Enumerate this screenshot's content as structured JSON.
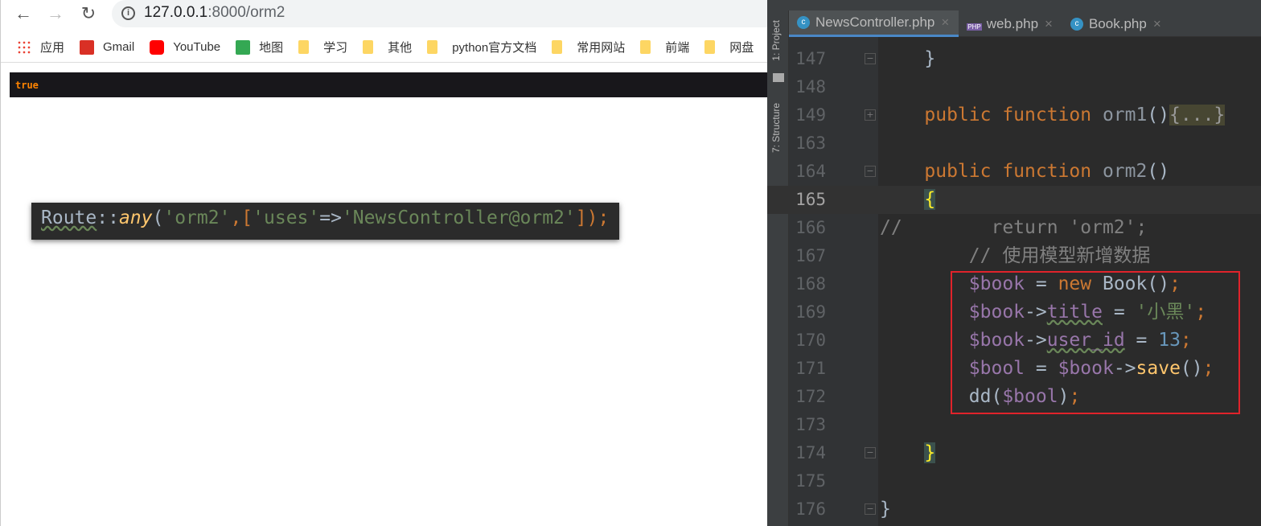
{
  "browser": {
    "url_host": "127.0.0.1",
    "url_path": ":8000/orm2",
    "bookmarks": [
      {
        "label": "应用",
        "icon": "apps-grid-icon"
      },
      {
        "label": "Gmail",
        "icon": "gmail-icon"
      },
      {
        "label": "YouTube",
        "icon": "youtube-icon"
      },
      {
        "label": "地图",
        "icon": "maps-icon"
      },
      {
        "label": "学习",
        "icon": "folder-icon"
      },
      {
        "label": "其他",
        "icon": "folder-icon"
      },
      {
        "label": "python官方文档",
        "icon": "folder-icon"
      },
      {
        "label": "常用网站",
        "icon": "folder-icon"
      },
      {
        "label": "前端",
        "icon": "folder-icon"
      },
      {
        "label": "网盘",
        "icon": "folder-icon"
      }
    ],
    "dump_output": "true"
  },
  "tooltip": {
    "tokens": [
      {
        "t": "Route",
        "k": "wavy"
      },
      {
        "t": "::",
        "k": ""
      },
      {
        "t": "any",
        "k": "ital"
      },
      {
        "t": "(",
        "k": ""
      },
      {
        "t": "'orm2'",
        "k": "str"
      },
      {
        "t": ",[",
        "k": "kw"
      },
      {
        "t": "'uses'",
        "k": "str"
      },
      {
        "t": "=>",
        "k": ""
      },
      {
        "t": "'NewsController@orm2'",
        "k": "str"
      },
      {
        "t": "]);",
        "k": "kw"
      }
    ]
  },
  "ide": {
    "side_tools": [
      "1: Project",
      "7: Structure"
    ],
    "tabs": [
      {
        "label": "NewsController.php",
        "icon": "class-icon",
        "active": true
      },
      {
        "label": "web.php",
        "icon": "php-file-icon"
      },
      {
        "label": "Book.php",
        "icon": "class-icon"
      }
    ],
    "current_line": "165",
    "lines": [
      {
        "n": "147",
        "fold": "-",
        "tokens": [
          {
            "t": "    }",
            "k": ""
          }
        ]
      },
      {
        "n": "148",
        "tokens": []
      },
      {
        "n": "149",
        "fold": "+",
        "tokens": [
          {
            "t": "    public function ",
            "k": "kw"
          },
          {
            "t": "orm1",
            "k": "dim"
          },
          {
            "t": "()",
            "k": ""
          },
          {
            "t": "{...}",
            "k": "folded"
          }
        ]
      },
      {
        "n": "163",
        "tokens": []
      },
      {
        "n": "164",
        "fold": "-",
        "tokens": [
          {
            "t": "    public function ",
            "k": "kw"
          },
          {
            "t": "orm2",
            "k": "dim"
          },
          {
            "t": "()",
            "k": ""
          }
        ]
      },
      {
        "n": "165",
        "tokens": [
          {
            "t": "    ",
            "k": ""
          },
          {
            "t": "{",
            "k": "br"
          }
        ]
      },
      {
        "n": "166",
        "tokens": [
          {
            "t": "//        return 'orm2';",
            "k": "cm"
          }
        ]
      },
      {
        "n": "167",
        "tokens": [
          {
            "t": "        // 使用模型新增数据",
            "k": "cm"
          }
        ]
      },
      {
        "n": "168",
        "tokens": [
          {
            "t": "        ",
            "k": ""
          },
          {
            "t": "$book",
            "k": "var"
          },
          {
            "t": " = ",
            "k": ""
          },
          {
            "t": "new ",
            "k": "kw"
          },
          {
            "t": "Book()",
            "k": ""
          },
          {
            "t": ";",
            "k": "kw"
          }
        ]
      },
      {
        "n": "169",
        "tokens": [
          {
            "t": "        ",
            "k": ""
          },
          {
            "t": "$book",
            "k": "var"
          },
          {
            "t": "->",
            "k": ""
          },
          {
            "t": "title",
            "k": "var wavy"
          },
          {
            "t": " = ",
            "k": ""
          },
          {
            "t": "'小黑'",
            "k": "str"
          },
          {
            "t": ";",
            "k": "kw"
          }
        ]
      },
      {
        "n": "170",
        "tokens": [
          {
            "t": "        ",
            "k": ""
          },
          {
            "t": "$book",
            "k": "var"
          },
          {
            "t": "->",
            "k": ""
          },
          {
            "t": "user_id",
            "k": "var wavy"
          },
          {
            "t": " = ",
            "k": ""
          },
          {
            "t": "13",
            "k": "num"
          },
          {
            "t": ";",
            "k": "kw"
          }
        ]
      },
      {
        "n": "171",
        "tokens": [
          {
            "t": "        ",
            "k": ""
          },
          {
            "t": "$bool",
            "k": "var"
          },
          {
            "t": " = ",
            "k": ""
          },
          {
            "t": "$book",
            "k": "var"
          },
          {
            "t": "->",
            "k": ""
          },
          {
            "t": "save",
            "k": "fn"
          },
          {
            "t": "()",
            "k": ""
          },
          {
            "t": ";",
            "k": "kw"
          }
        ]
      },
      {
        "n": "172",
        "tokens": [
          {
            "t": "        dd(",
            "k": ""
          },
          {
            "t": "$bool",
            "k": "var"
          },
          {
            "t": ")",
            "k": ""
          },
          {
            "t": ";",
            "k": "kw"
          }
        ]
      },
      {
        "n": "173",
        "tokens": []
      },
      {
        "n": "174",
        "fold": "-",
        "tokens": [
          {
            "t": "    ",
            "k": ""
          },
          {
            "t": "}",
            "k": "br"
          }
        ]
      },
      {
        "n": "175",
        "tokens": []
      },
      {
        "n": "176",
        "fold": "-",
        "tokens": [
          {
            "t": "}",
            "k": ""
          }
        ]
      }
    ],
    "highlight_color": "#e0232b"
  }
}
